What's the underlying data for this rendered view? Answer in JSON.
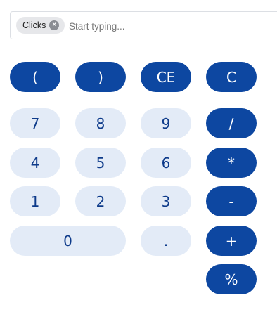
{
  "input": {
    "chips": [
      {
        "label": "Clicks",
        "close_icon": "close-icon"
      }
    ],
    "value": "",
    "placeholder": "Start typing..."
  },
  "keys": {
    "open_paren": "(",
    "close_paren": ")",
    "clear_entry": "CE",
    "clear": "C",
    "seven": "7",
    "eight": "8",
    "nine": "9",
    "divide": "/",
    "four": "4",
    "five": "5",
    "six": "6",
    "multiply": "*",
    "one": "1",
    "two": "2",
    "three": "3",
    "subtract": "-",
    "zero": "0",
    "decimal": ".",
    "add": "+",
    "percent": "%"
  },
  "colors": {
    "operator_key": "#0d47a1",
    "digit_key": "#e3ebf7",
    "digit_text": "#0d3a8a",
    "chip_bg": "#e6e7ea"
  }
}
